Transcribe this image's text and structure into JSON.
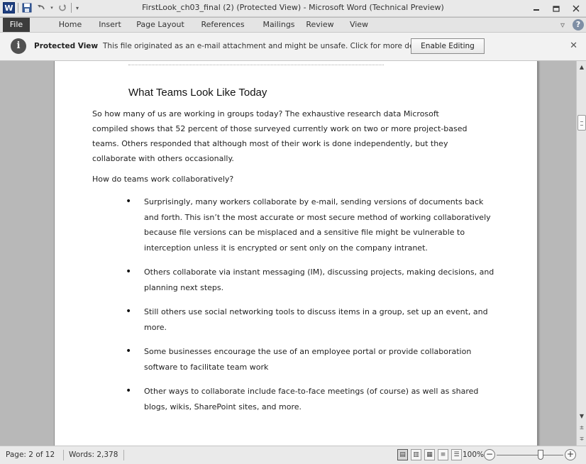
{
  "window": {
    "title": "FirstLook_ch03_final (2) (Protected View) - Microsoft Word (Technical Preview)",
    "app_logo": "W",
    "controls": [
      "minimize-icon",
      "restore-icon",
      "close-icon"
    ]
  },
  "qat": {
    "icons": [
      "save-icon",
      "undo-icon",
      "redo-icon",
      "customize-qat-icon"
    ]
  },
  "ribbon": {
    "tabs": [
      "File",
      "Home",
      "Insert",
      "Page Layout",
      "References",
      "Mailings",
      "Review",
      "View"
    ]
  },
  "protected_view": {
    "title": "Protected View",
    "message": "This file originated as an e-mail attachment and might be unsafe. Click for more details.",
    "button": "Enable Editing"
  },
  "document": {
    "heading": "What Teams Look Like Today",
    "paragraph1": "So how many of us are working in groups today? The exhaustive research data Microsoft compiled shows that 52 percent of those surveyed currently work on two or more project-based teams. Others responded that although most of their work is done independently, but they collaborate with others occasionally.",
    "paragraph2": "How do teams work collaboratively?",
    "bullets": [
      "Surprisingly, many workers collaborate by e-mail, sending versions of documents back and forth. This isn’t the most accurate or most secure method of working collaboratively because file versions can be misplaced and a sensitive file might be vulnerable to interception unless it is encrypted or sent only on the company intranet.",
      "Others collaborate via instant messaging (IM), discussing projects, making decisions, and planning next steps.",
      "Still others use social networking tools to discuss items in a group, set up an event, and more.",
      "Some businesses encourage the use of an employee portal or provide collaboration software to facilitate team work",
      "Other ways to collaborate include face-to-face meetings (of course) as well as shared blogs, wikis, SharePoint sites, and more."
    ]
  },
  "status": {
    "page": "Page: 2 of 12",
    "words": "Words: 2,378",
    "zoom": "100%",
    "zoom_level_percent": 100
  }
}
